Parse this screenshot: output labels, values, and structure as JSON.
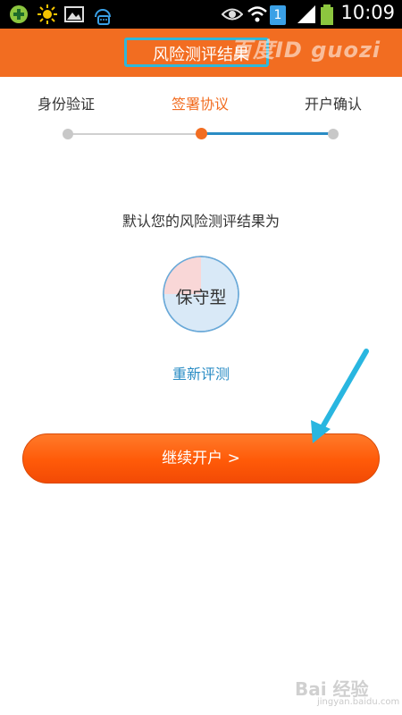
{
  "status_bar": {
    "time": "10:09",
    "sim_badge": "1",
    "icons": [
      "plus-app-icon",
      "sun-icon",
      "image-icon",
      "headset-chat-icon",
      "eye-icon",
      "wifi-icon",
      "signal-icon",
      "battery-icon"
    ]
  },
  "header": {
    "title": "风险测评结果",
    "watermark": "百度ID guozi",
    "frame_color": "#2fb7d9",
    "bg_color": "#f26d21"
  },
  "steps": {
    "items": [
      {
        "label": "身份验证",
        "state": "done"
      },
      {
        "label": "签署协议",
        "state": "current"
      },
      {
        "label": "开户确认",
        "state": "pending"
      }
    ],
    "accent_color": "#f26d21",
    "progress_color": "#2a8cc4"
  },
  "result": {
    "caption": "默认您的风险测评结果为",
    "type_label": "保守型",
    "pie_share": 0.25,
    "retest_label": "重新评测"
  },
  "continue_button": {
    "label": "继续开户 >"
  },
  "baidu_watermark": {
    "logo": "Bai 经验",
    "url": "jingyan.baidu.com"
  }
}
